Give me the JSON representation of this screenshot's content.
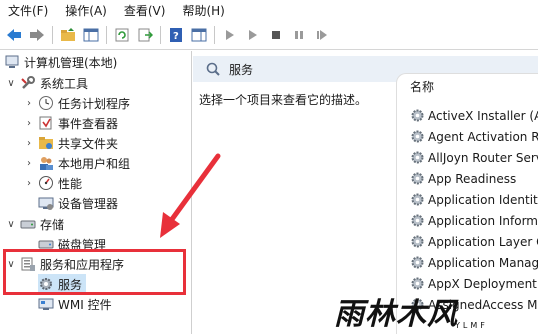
{
  "menu": [
    "文件(F)",
    "操作(A)",
    "查看(V)",
    "帮助(H)"
  ],
  "toolbar_icons": [
    "back-arrow-icon",
    "forward-arrow-icon",
    "up-folder-icon",
    "show-hide-tree-icon",
    "refresh-icon",
    "export-list-icon",
    "help-icon",
    "action-pane-icon",
    "play-icon",
    "play-alt-icon",
    "stop-icon",
    "pause-icon",
    "restart-icon"
  ],
  "tree": {
    "root": "计算机管理(本地)",
    "system_tools": "系统工具",
    "task_scheduler": "任务计划程序",
    "event_viewer": "事件查看器",
    "shared_folders": "共享文件夹",
    "local_users": "本地用户和组",
    "performance": "性能",
    "device_manager": "设备管理器",
    "storage": "存储",
    "disk_management": "磁盘管理",
    "services_apps": "服务和应用程序",
    "services": "服务",
    "wmi": "WMI 控件"
  },
  "panel": {
    "title": "服务",
    "description": "选择一个项目来查看它的描述。",
    "column_name": "名称",
    "services": [
      "ActiveX Installer (Ax",
      "Agent Activation Ru",
      "AllJoyn Router Serv",
      "App Readiness",
      "Application Identity",
      "Application Informa",
      "Application Layer G",
      "Application Manag",
      "AppX Deployment Se",
      "AssignedAccess Man"
    ]
  },
  "watermark": {
    "main": "雨林木风",
    "sub": "YLMF"
  },
  "colors": {
    "callout": "#e8303a",
    "selection": "#cce4f7",
    "header_bg": "#eaf0f7"
  }
}
